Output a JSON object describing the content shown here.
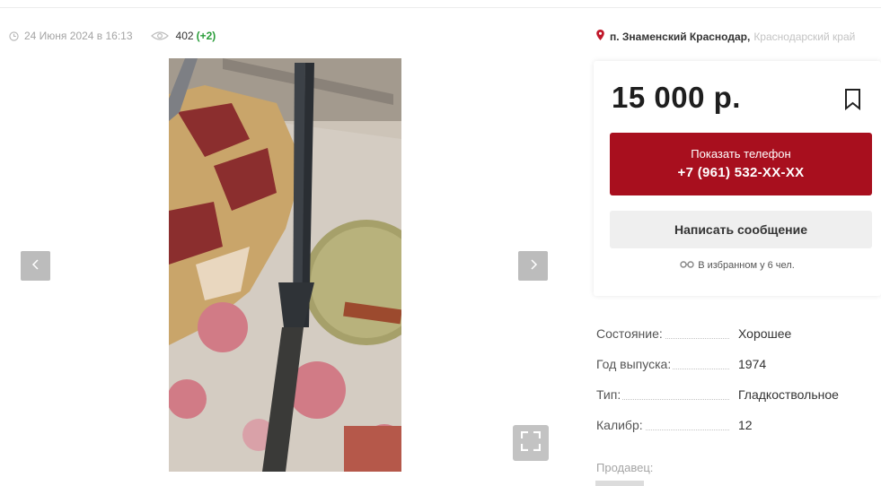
{
  "listing": {
    "date": "24 Июня 2024 в 16:13",
    "views": "402",
    "views_delta": "(+2)"
  },
  "location": {
    "city": "п. Знаменский Краснодар,",
    "region": "Краснодарский край"
  },
  "price_card": {
    "price": "15 000 р.",
    "phone_label": "Показать телефон",
    "phone_number": "+7 (961) 532-XX-XX",
    "message_label": "Написать сообщение",
    "favorites_text": "В избранном у 6 чел."
  },
  "properties": [
    {
      "label": "Состояние:",
      "value": "Хорошее"
    },
    {
      "label": "Год выпуска:",
      "value": "1974"
    },
    {
      "label": "Тип:",
      "value": "Гладкоствольное"
    },
    {
      "label": "Калибр:",
      "value": "12"
    }
  ],
  "seller": {
    "label": "Продавец:"
  },
  "colors": {
    "accent": "#a80f1e",
    "views_delta": "#2a9d3a",
    "location_pin": "#c0182a"
  },
  "icons": [
    "clock-icon",
    "eye-icon",
    "location-pin-icon",
    "bookmark-icon",
    "chevron-left-icon",
    "chevron-right-icon",
    "fullscreen-icon"
  ]
}
